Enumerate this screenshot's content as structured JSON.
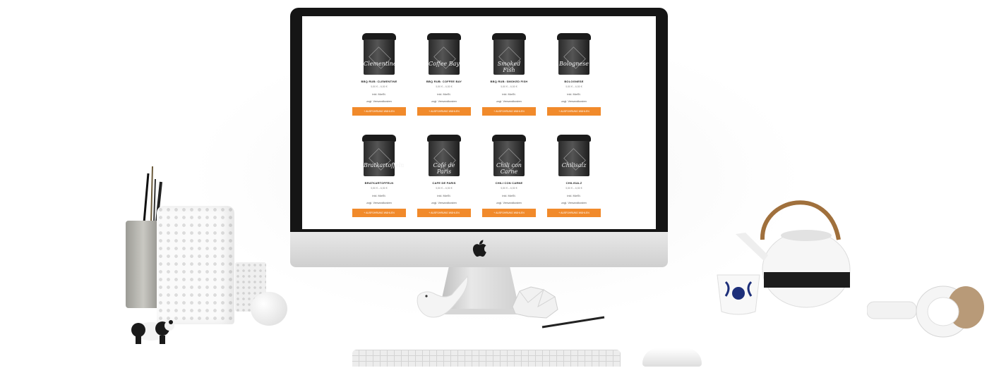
{
  "products": [
    {
      "name": "BBQ RUB: CLEMENTINE",
      "price": "5,50 € – 6,50 €",
      "tax": "inkl. MwSt.",
      "shipping": "zzgl. Versandkosten",
      "button": "+ AUSFÜHRUNG WÄHLEN",
      "tin_script": "Clementine"
    },
    {
      "name": "BBQ RUB: COFFEE BAY",
      "price": "5,50 € – 6,50 €",
      "tax": "inkl. MwSt.",
      "shipping": "zzgl. Versandkosten",
      "button": "+ AUSFÜHRUNG WÄHLEN",
      "tin_script": "Coffee Bay"
    },
    {
      "name": "BBQ RUB: SMOKED FISH",
      "price": "5,50 € – 6,50 €",
      "tax": "inkl. MwSt.",
      "shipping": "zzgl. Versandkosten",
      "button": "+ AUSFÜHRUNG WÄHLEN",
      "tin_script": "Smoked Fish"
    },
    {
      "name": "BOLOGNESE",
      "price": "5,50 € – 6,50 €",
      "tax": "inkl. MwSt.",
      "shipping": "zzgl. Versandkosten",
      "button": "+ AUSFÜHRUNG WÄHLEN",
      "tin_script": "Bolognese"
    },
    {
      "name": "BRATKARTOFFELN",
      "price": "5,50 € – 6,50 €",
      "tax": "inkl. MwSt.",
      "shipping": "zzgl. Versandkosten",
      "button": "+ AUSFÜHRUNG WÄHLEN",
      "tin_script": "Bratkartoffeln"
    },
    {
      "name": "CAFE DE PARIS",
      "price": "5,50 € – 6,50 €",
      "tax": "inkl. MwSt.",
      "shipping": "zzgl. Versandkosten",
      "button": "+ AUSFÜHRUNG WÄHLEN",
      "tin_script": "Café de Paris"
    },
    {
      "name": "CHILI CON CARNE",
      "price": "5,50 € – 6,50 €",
      "tax": "inkl. MwSt.",
      "shipping": "zzgl. Versandkosten",
      "button": "+ AUSFÜHRUNG WÄHLEN",
      "tin_script": "Chili con Carne"
    },
    {
      "name": "CHILISALZ",
      "price": "5,50 € – 6,50 €",
      "tax": "inkl. MwSt.",
      "shipping": "zzgl. Versandkosten",
      "button": "+ AUSFÜHRUNG WÄHLEN",
      "tin_script": "Chilisalz"
    }
  ],
  "colors": {
    "button": "#f18a2b",
    "bezel": "#151515",
    "page": "#ffffff"
  },
  "icons": {
    "monitor_logo": "apple-logo-icon"
  }
}
